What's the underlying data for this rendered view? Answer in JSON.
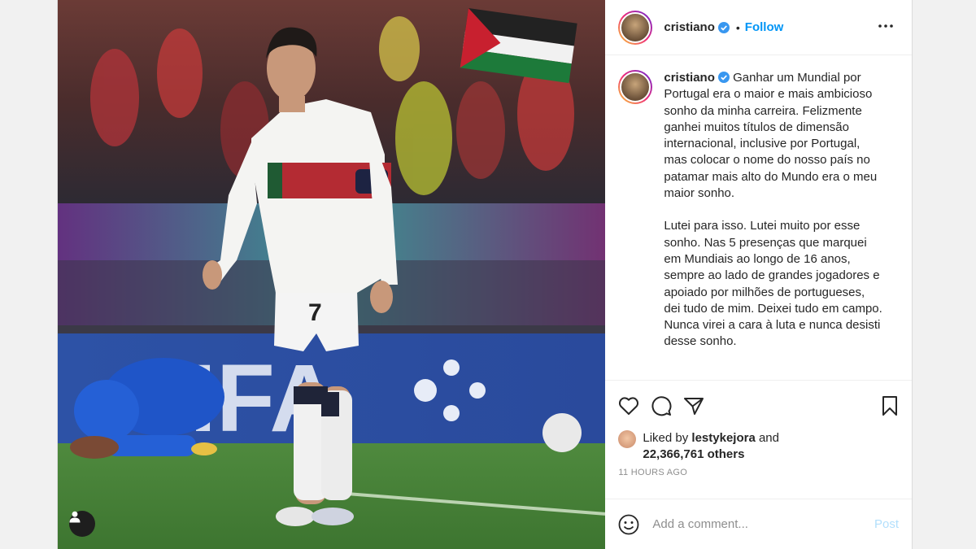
{
  "post": {
    "username": "cristiano",
    "follow_label": "Follow",
    "dot": "•",
    "caption_p1": "Ganhar um Mundial por Portugal era o maior e mais ambicioso sonho da minha carreira. Felizmente ganhei muitos títulos de dimensão internacional, inclusive por Portugal, mas colocar o nome do nosso país no patamar mais alto do Mundo era o meu maior sonho.",
    "caption_p2": "Lutei para isso. Lutei muito por esse sonho. Nas 5 presenças que marquei em Mundiais ao longo de 16 anos, sempre ao lado de grandes jogadores e apoiado por milhões de portugueses, dei tudo de mim. Deixei tudo em campo. Nunca virei a cara à luta e nunca desisti desse sonho.",
    "liked_by_prefix": "Liked by",
    "liked_by_user": "lestykejora",
    "liked_by_and": "and",
    "likes_others": "22,366,761 others",
    "timestamp": "11 HOURS AGO"
  },
  "comment": {
    "placeholder": "Add a comment...",
    "post_label": "Post"
  },
  "photo": {
    "board_text": "FIFA",
    "shirt_number": "7"
  },
  "colors": {
    "accent": "#0095f6",
    "post_disabled": "#b2dffc",
    "verified": "#3897f0"
  },
  "icons": [
    "verified-icon",
    "more-icon",
    "heart-icon",
    "comment-icon",
    "share-icon",
    "save-icon",
    "emoji-icon",
    "tagged-user-icon"
  ]
}
